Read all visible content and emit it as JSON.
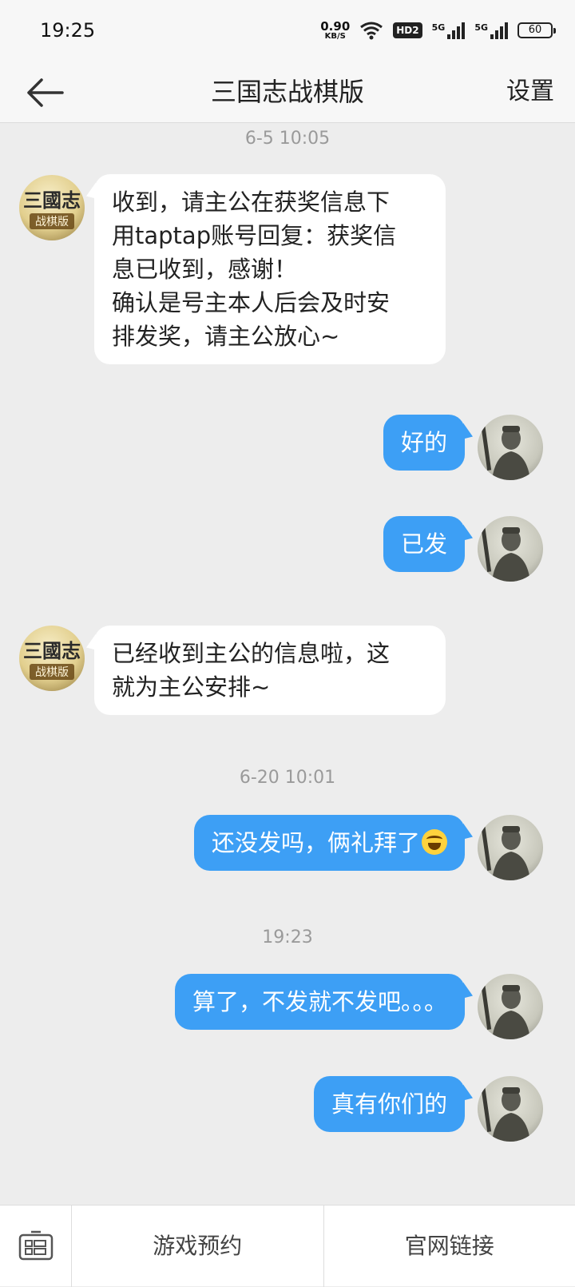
{
  "status_bar": {
    "time": "19:25",
    "net_speed_value": "0.90",
    "net_speed_unit": "KB/S",
    "hd_badge": "HD2",
    "signal_1": "5G",
    "signal_2": "5G",
    "battery": "60"
  },
  "header": {
    "back_icon": "arrow-left-icon",
    "title": "三国志战棋版",
    "settings_label": "设置"
  },
  "messages": [
    {
      "type": "timestamp",
      "text": "6-5 10:05"
    },
    {
      "type": "message",
      "sender": "game",
      "lines": [
        "收到，请主公在获奖信息下",
        "用taptap账号回复：获奖信",
        "息已收到，感谢！",
        "确认是号主本人后会及时安",
        "排发奖，请主公放心~"
      ]
    },
    {
      "type": "message",
      "sender": "user",
      "text": "好的"
    },
    {
      "type": "message",
      "sender": "user",
      "text": "已发"
    },
    {
      "type": "message",
      "sender": "game",
      "lines": [
        "已经收到主公的信息啦，这",
        "就为主公安排~"
      ]
    },
    {
      "type": "timestamp",
      "text": "6-20 10:01"
    },
    {
      "type": "message",
      "sender": "user",
      "text": "还没发吗，俩礼拜了",
      "emoji": "laughing-crying-emoji"
    },
    {
      "type": "timestamp",
      "text": "19:23"
    },
    {
      "type": "message",
      "sender": "user",
      "text": "算了，不发就不发吧。。。"
    },
    {
      "type": "message",
      "sender": "user",
      "text": "真有你们的"
    }
  ],
  "game_avatar": {
    "logo_text": "三國志",
    "subtitle": "战棋版"
  },
  "bottom_menu": {
    "keyboard_icon": "keyboard-icon",
    "items": [
      "游戏预约",
      "官网链接"
    ]
  },
  "colors": {
    "outgoing_bubble": "#3d9ff5",
    "incoming_bubble": "#ffffff",
    "chat_background": "#ededed"
  }
}
